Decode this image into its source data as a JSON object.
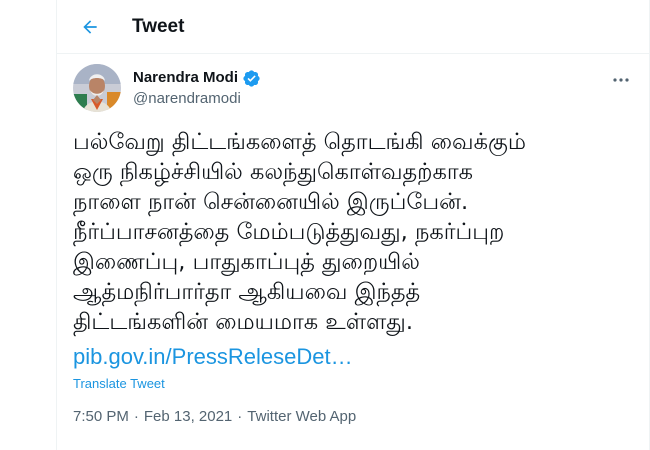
{
  "header": {
    "title": "Tweet"
  },
  "icons": {
    "back": "arrow-left-icon",
    "verified": "verified-badge-icon",
    "more": "more-dots-icon"
  },
  "colors": {
    "accent": "#1b95e0",
    "secondary_text": "#536471",
    "primary_text": "#0f1419"
  },
  "tweet": {
    "author_name": "Narendra Modi",
    "author_handle": "@narendramodi",
    "text": "பல்வேறு திட்டங்களைத் தொடங்கி வைக்கும்\nஒரு நிகழ்ச்சியில் கலந்துகொள்வதற்காக\nநாளை நான்  சென்னையில் இருப்பேன்.\nநீர்ப்பாசனத்தை மேம்படுத்துவது, நகர்ப்புற\nஇணைப்பு, பாதுகாப்புத் துறையில்\nஆத்மநிர்பார்தா ஆகியவை இந்தத்\nதிட்டங்களின் மையமாக   உள்ளது.",
    "link_text": "pib.gov.in/PressReleseDet…",
    "translate_label": "Translate Tweet",
    "time": "7:50 PM",
    "date": "Feb 13, 2021",
    "separator": "·",
    "source": "Twitter Web App"
  }
}
